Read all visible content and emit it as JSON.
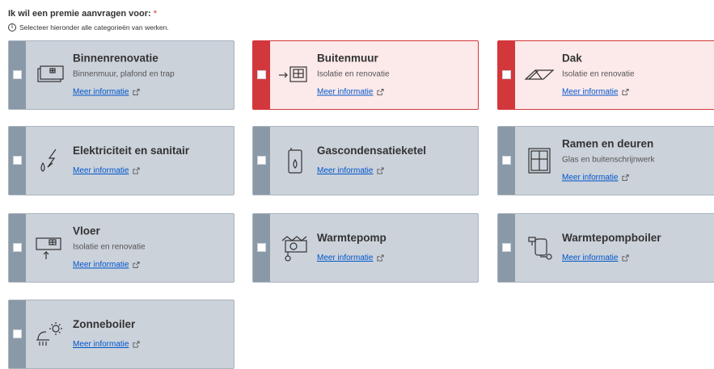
{
  "question": {
    "label": "Ik wil een premie aanvragen voor:",
    "required_mark": "*",
    "hint": "Selecteer hieronder alle categorieën van werken.",
    "hint_icon": "info-icon"
  },
  "categories": [
    {
      "title": "Binnenrenovatie",
      "desc": "Binnenmuur, plafond en trap",
      "link": "Meer informatie",
      "icon": "interior-wall-icon",
      "selected": false
    },
    {
      "title": "Buitenmuur",
      "desc": "Isolatie en renovatie",
      "link": "Meer informatie",
      "icon": "exterior-wall-icon",
      "selected": true
    },
    {
      "title": "Dak",
      "desc": "Isolatie en renovatie",
      "link": "Meer informatie",
      "icon": "roof-icon",
      "selected": true
    },
    {
      "title": "Elektriciteit en sanitair",
      "desc": "",
      "link": "Meer informatie",
      "icon": "electricity-water-icon",
      "selected": false
    },
    {
      "title": "Gascondensatieketel",
      "desc": "",
      "link": "Meer informatie",
      "icon": "boiler-icon",
      "selected": false
    },
    {
      "title": "Ramen en deuren",
      "desc": "Glas en buitenschrijnwerk",
      "link": "Meer informatie",
      "icon": "window-icon",
      "selected": false
    },
    {
      "title": "Vloer",
      "desc": "Isolatie en renovatie",
      "link": "Meer informatie",
      "icon": "floor-icon",
      "selected": false
    },
    {
      "title": "Warmtepomp",
      "desc": "",
      "link": "Meer informatie",
      "icon": "heat-pump-icon",
      "selected": false
    },
    {
      "title": "Warmtepompboiler",
      "desc": "",
      "link": "Meer informatie",
      "icon": "heat-pump-boiler-icon",
      "selected": false
    },
    {
      "title": "Zonneboiler",
      "desc": "",
      "link": "Meer informatie",
      "icon": "solar-boiler-icon",
      "selected": false
    }
  ],
  "colors": {
    "accent_selected": "#d2373c",
    "card_bg": "#cbd2da",
    "strip": "#8a99a8",
    "link": "#0055cc"
  }
}
